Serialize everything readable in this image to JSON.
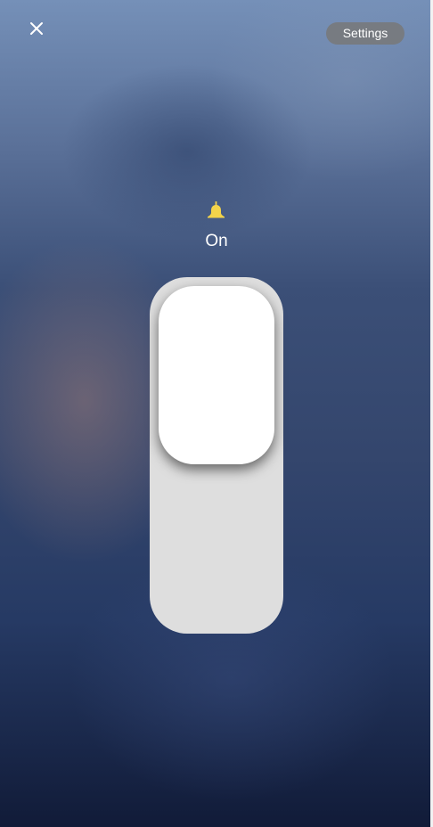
{
  "header": {
    "close_icon": "close-icon",
    "settings_label": "Settings"
  },
  "status": {
    "icon": "bell-icon",
    "icon_color": "#f3d34a",
    "label": "On"
  },
  "toggle": {
    "state": "on",
    "track_color": "#dedede",
    "thumb_color": "#ffffff"
  }
}
